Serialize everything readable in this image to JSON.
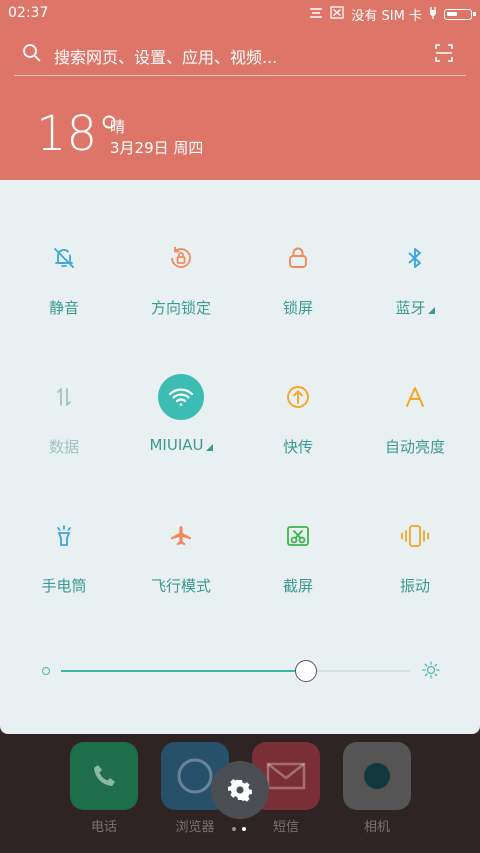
{
  "status_bar": {
    "time": "02:37",
    "no_sim": "没有 SIM 卡"
  },
  "search": {
    "placeholder": "搜索网页、设置、应用、视频..."
  },
  "weather": {
    "temperature": "18°",
    "condition": "晴",
    "date": "3月29日 周四"
  },
  "toggles": [
    {
      "label": "静音",
      "icon": "bell-off-icon",
      "active": false
    },
    {
      "label": "方向锁定",
      "icon": "rotation-lock-icon",
      "active": false
    },
    {
      "label": "锁屏",
      "icon": "lock-icon",
      "active": false
    },
    {
      "label": "蓝牙",
      "icon": "bluetooth-icon",
      "active": false
    },
    {
      "label": "数据",
      "icon": "mobile-data-icon",
      "active": false
    },
    {
      "label": "MIUIAU",
      "icon": "wifi-icon",
      "active": true
    },
    {
      "label": "快传",
      "icon": "fast-transfer-icon",
      "active": false
    },
    {
      "label": "自动亮度",
      "icon": "auto-brightness-icon",
      "active": false
    },
    {
      "label": "手电筒",
      "icon": "flashlight-icon",
      "active": false
    },
    {
      "label": "飞行模式",
      "icon": "airplane-icon",
      "active": false
    },
    {
      "label": "截屏",
      "icon": "screenshot-icon",
      "active": false
    },
    {
      "label": "振动",
      "icon": "vibrate-icon",
      "active": false
    }
  ],
  "brightness": {
    "level": 0.7
  },
  "dock": [
    {
      "label": "电话",
      "icon": "phone-icon",
      "color": "#1f6d4a"
    },
    {
      "label": "浏览器",
      "icon": "browser-icon",
      "color": "#27506a"
    },
    {
      "label": "短信",
      "icon": "message-icon",
      "color": "#7a2f37"
    },
    {
      "label": "相机",
      "icon": "camera-icon",
      "color": "#555555"
    }
  ],
  "colors": {
    "accent": "#3b9a92",
    "header": "#dd7568",
    "panel": "#e9f0f1"
  }
}
